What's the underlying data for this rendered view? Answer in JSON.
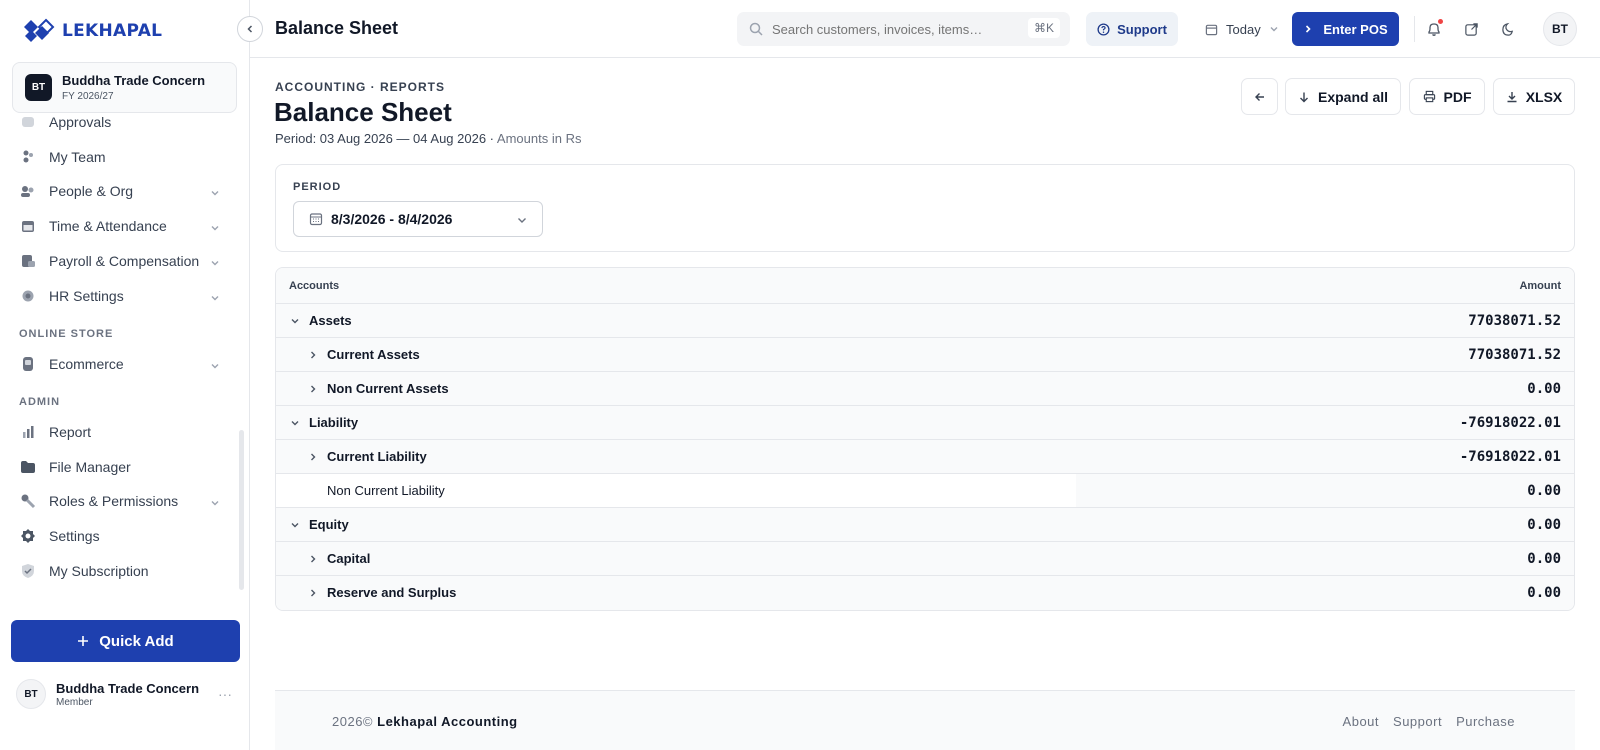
{
  "brand": {
    "name": "LEKHAPAL",
    "color": "#1e40af"
  },
  "company": {
    "initials": "BT",
    "name": "Buddha Trade Concern",
    "fiscal_year": "FY 2026/27"
  },
  "sidebar": {
    "partial_item": "Approvals",
    "items": [
      {
        "label": "My Team",
        "icon": "team-icon"
      },
      {
        "label": "People & Org",
        "icon": "people-icon",
        "expandable": true
      },
      {
        "label": "Time & Attendance",
        "icon": "calendar-icon",
        "expandable": true
      },
      {
        "label": "Payroll & Compensation",
        "icon": "payroll-icon",
        "expandable": true
      },
      {
        "label": "HR Settings",
        "icon": "gear-icon",
        "expandable": true
      }
    ],
    "section_online": "ONLINE STORE",
    "online_items": [
      {
        "label": "Ecommerce",
        "icon": "store-icon",
        "expandable": true
      }
    ],
    "section_admin": "ADMIN",
    "admin_items": [
      {
        "label": "Report",
        "icon": "bar-chart-icon"
      },
      {
        "label": "File Manager",
        "icon": "folder-icon"
      },
      {
        "label": "Roles & Permissions",
        "icon": "key-icon",
        "expandable": true
      },
      {
        "label": "Settings",
        "icon": "settings-icon"
      },
      {
        "label": "My Subscription",
        "icon": "shield-icon"
      }
    ],
    "quick_add": "Quick Add",
    "user": {
      "initials": "BT",
      "name": "Buddha Trade Concern",
      "role": "Member",
      "more": "···"
    }
  },
  "topbar": {
    "title": "Balance Sheet",
    "search_placeholder": "Search customers, invoices, items…",
    "shortcut": "⌘K",
    "support": "Support",
    "date_filter": "Today",
    "enter_pos": "Enter POS",
    "avatar": "BT"
  },
  "page": {
    "breadcrumb": "ACCOUNTING · REPORTS",
    "title": "Balance Sheet",
    "period_text": "Period: 03 Aug 2026 — 04 Aug 2026 ·",
    "amounts_note": "Amounts in Rs",
    "actions": {
      "expand_all": "Expand all",
      "pdf": "PDF",
      "xlsx": "XLSX"
    }
  },
  "filter": {
    "label": "PERIOD",
    "date_range": "8/3/2026 - 8/4/2026"
  },
  "table": {
    "headers": {
      "accounts": "Accounts",
      "amount": "Amount"
    },
    "rows": [
      {
        "label": "Assets",
        "amount": "77038071.52",
        "level": 0,
        "caret": "down"
      },
      {
        "label": "Current Assets",
        "amount": "77038071.52",
        "level": 1,
        "caret": "right"
      },
      {
        "label": "Non Current Assets",
        "amount": "0.00",
        "level": 1,
        "caret": "right"
      },
      {
        "label": "Liability",
        "amount": "-76918022.01",
        "level": 0,
        "caret": "down"
      },
      {
        "label": "Current Liability",
        "amount": "-76918022.01",
        "level": 1,
        "caret": "right"
      },
      {
        "label": "Non Current Liability",
        "amount": "0.00",
        "level": 1,
        "caret": "none"
      },
      {
        "label": "Equity",
        "amount": "0.00",
        "level": 0,
        "caret": "down"
      },
      {
        "label": "Capital",
        "amount": "0.00",
        "level": 1,
        "caret": "right"
      },
      {
        "label": "Reserve and Surplus",
        "amount": "0.00",
        "level": 1,
        "caret": "right"
      }
    ]
  },
  "footer": {
    "copyright_prefix": "2026©",
    "copyright_name": "Lekhapal Accounting",
    "links": [
      "About",
      "Support",
      "Purchase"
    ]
  }
}
